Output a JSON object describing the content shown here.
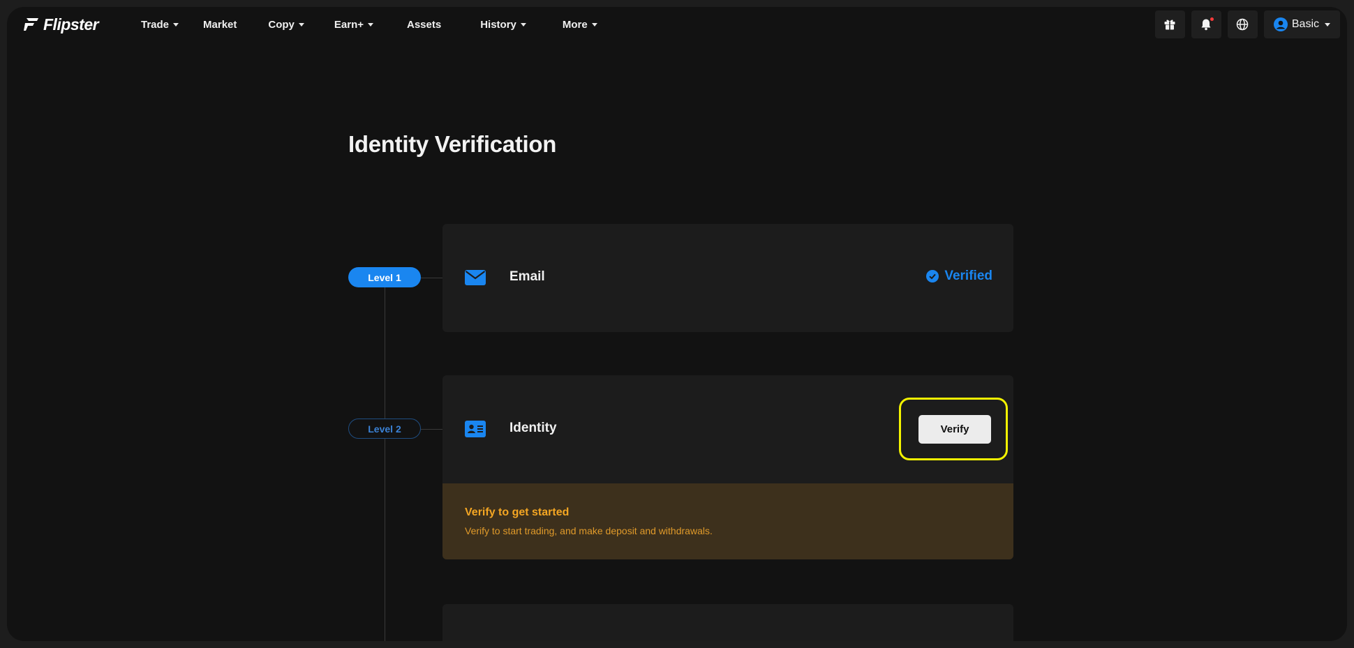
{
  "brand": {
    "name": "Flipster"
  },
  "nav": {
    "items": [
      {
        "label": "Trade",
        "has_dropdown": true
      },
      {
        "label": "Market",
        "has_dropdown": false
      },
      {
        "label": "Copy",
        "has_dropdown": true
      },
      {
        "label": "Earn+",
        "has_dropdown": true
      },
      {
        "label": "Assets",
        "has_dropdown": false
      },
      {
        "label": "History",
        "has_dropdown": true
      },
      {
        "label": "More",
        "has_dropdown": true
      }
    ],
    "right": {
      "icons": [
        "gift-icon",
        "bell-icon",
        "globe-icon"
      ],
      "account_label": "Basic"
    }
  },
  "page": {
    "title": "Identity Verification",
    "levels": [
      {
        "level_label": "Level 1",
        "title": "Email",
        "status": "Verified",
        "icon": "envelope-icon"
      },
      {
        "level_label": "Level 2",
        "title": "Identity",
        "action_label": "Verify",
        "icon": "id-card-icon",
        "notice": {
          "title": "Verify to get started",
          "text": "Verify to start trading, and make deposit and withdrawals."
        }
      }
    ]
  },
  "colors": {
    "accent": "#1a86f0",
    "background": "#121212",
    "card": "#1c1c1c",
    "notice_bg": "#3d301c",
    "notice_text": "#f4a623",
    "highlight": "#f3f300"
  }
}
